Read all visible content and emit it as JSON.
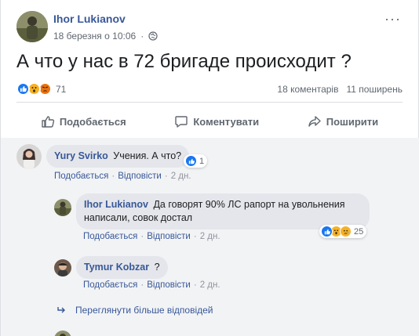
{
  "post": {
    "author": "Ihor Lukianov",
    "timestamp": "18 березня о 10:06",
    "privacy_icon": "globe-icon",
    "more_label": "···",
    "text": "А что у нас в 72 бригаде происходит ?",
    "reaction_count": "71",
    "comments_count": "18 коментарів",
    "shares_count": "11 поширень"
  },
  "actions": {
    "like": "Подобається",
    "comment": "Коментувати",
    "share": "Поширити"
  },
  "comments": [
    {
      "author": "Yury Svirko",
      "text": "Учения. А что?",
      "reactions": "1",
      "like": "Подобається",
      "reply": "Відповісти",
      "time": "2 дн."
    },
    {
      "author": "Ihor Lukianov",
      "text_line1": "Да говорят 90% ЛС рапорт на увольнения",
      "text_line2": "написали, совок достал",
      "reactions": "25",
      "like": "Подобається",
      "reply": "Відповісти",
      "time": "2 дн."
    },
    {
      "author": "Tymur Kobzar",
      "text": "?",
      "like": "Подобається",
      "reply": "Відповісти",
      "time": "2 дн."
    }
  ],
  "more_replies": "Переглянути більше відповідей",
  "colors": {
    "link": "#385898",
    "like_blue": "#1877f2",
    "wow_yellow": "#f7b125",
    "angry_orange": "#e9710f",
    "bubble": "#e4e6eb",
    "comments_bg": "#f2f3f5"
  }
}
